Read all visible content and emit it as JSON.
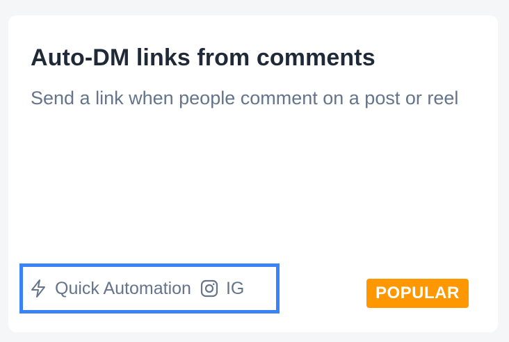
{
  "card": {
    "title": "Auto-DM links from comments",
    "description": "Send a link when people comment on a post or reel",
    "meta": {
      "type_icon": "lightning-bolt-icon",
      "type_label": "Quick Automation",
      "platform_icon": "instagram-icon",
      "platform_label": "IG"
    },
    "badge": {
      "label": "POPULAR",
      "color": "#ff9800"
    },
    "highlight_color": "#3b82f6"
  }
}
